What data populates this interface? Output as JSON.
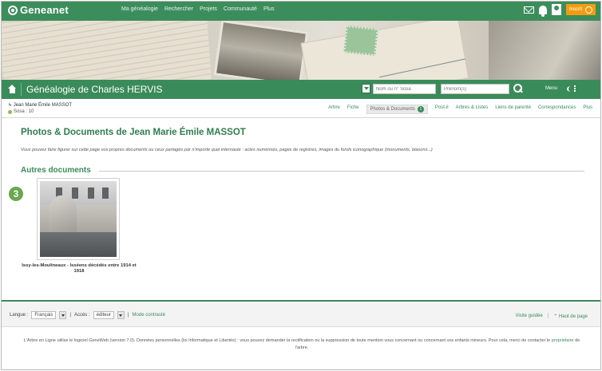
{
  "topbar": {
    "logo": "Geneanet",
    "nav": [
      "Ma généalogie",
      "Rechercher",
      "Projets",
      "Communauté",
      "Plus"
    ],
    "account_label": "Inscrit"
  },
  "header": {
    "title": "Généalogie de Charles HERVIS",
    "sosa_placeholder": "Nom ou n° Sosa",
    "prenom_placeholder": "Prénom(s)",
    "menu_label": "Menu"
  },
  "person": {
    "name": "Jean Marie Émile MASSOT",
    "sosa": "Sosa : 10"
  },
  "tabs": [
    "Arbre",
    "Fiche",
    "Photos & Documents",
    "Post-il",
    "Arbres & Listes",
    "Liens de parenté",
    "Correspondances",
    "Plus"
  ],
  "tab_badge": "1",
  "main": {
    "title": "Photos & Documents de Jean Marie Émile MASSOT",
    "intro": "Vous pouvez faire figurer sur cette page vos propres documents ou ceux partagés par n'importe quel internaute : actes numérisés, pages de registres, images du fonds iconographique (monuments, blasons...)",
    "section": "Autres documents",
    "step_badge": "3",
    "document_caption": "Issy-les-Moulineaux - Isséens décédés entre 1914 et 1918"
  },
  "footer": {
    "langue_label": "Langue :",
    "langue_value": "Français",
    "acces_label": "Accès :",
    "acces_value": "éditeur",
    "mode_link": "Mode contrasté",
    "guide_link": "Visite guidée",
    "top_link": "Haut de page",
    "legal_part1": "L'Arbre en Ligne utilise le logiciel GeneWeb (version 7.0). Données personnelles (loi Informatique et Libertés) : vous pouvez demander la rectification ou la suppression de toute mention vous concernant ou concernant vos enfants mineurs. Pour cela, merci de contacter le",
    "legal_owner": "propriétaire",
    "legal_part2": "de l'arbre."
  }
}
